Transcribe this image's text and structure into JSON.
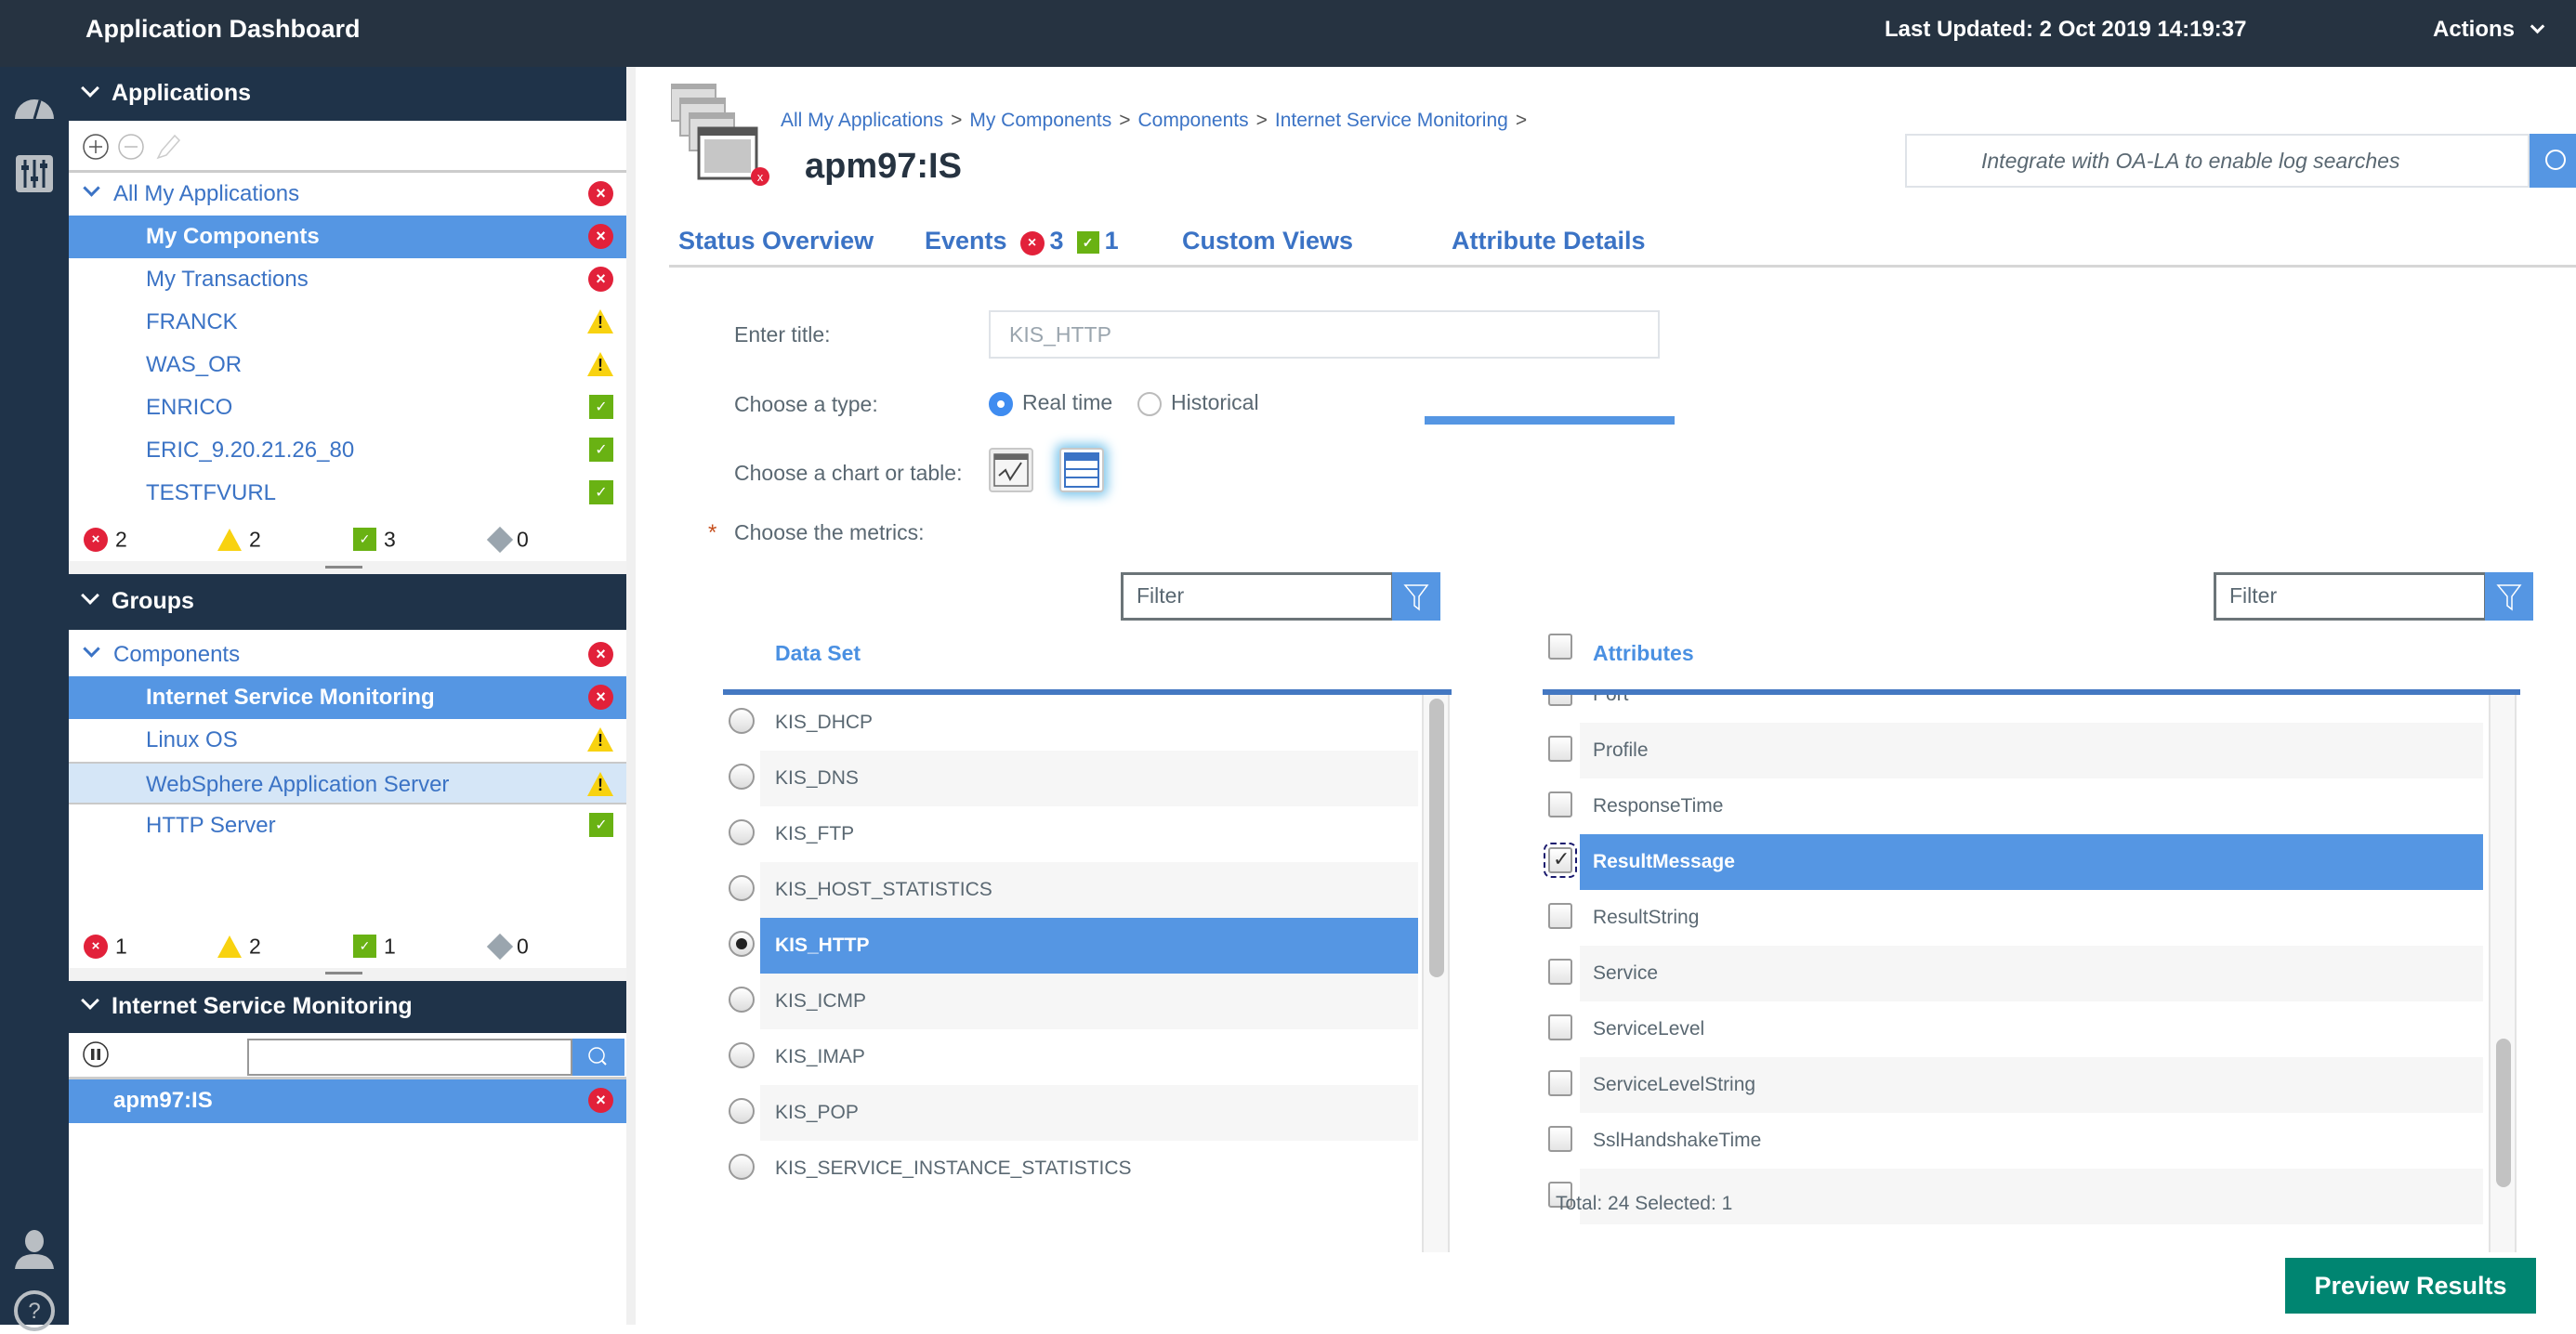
{
  "topbar": {
    "title": "Application Dashboard",
    "last_updated": "Last Updated: 2 Oct 2019 14:19:37",
    "actions_label": "Actions"
  },
  "rail": {
    "icons": [
      "home-icon",
      "dashboard-gauge-icon",
      "settings-sliders-icon",
      "user-icon",
      "help-icon"
    ]
  },
  "sidebar": {
    "applications": {
      "header": "Applications",
      "toolbar": [
        "add-icon",
        "remove-icon",
        "edit-icon"
      ],
      "root": {
        "label": "All My Applications",
        "status": "critical"
      },
      "items": [
        {
          "label": "My Components",
          "status": "critical",
          "selected": true
        },
        {
          "label": "My Transactions",
          "status": "critical"
        },
        {
          "label": "FRANCK",
          "status": "warning"
        },
        {
          "label": "WAS_OR",
          "status": "warning"
        },
        {
          "label": "ENRICO",
          "status": "normal"
        },
        {
          "label": "ERIC_9.20.21.26_80",
          "status": "normal"
        },
        {
          "label": "TESTFVURL",
          "status": "normal"
        }
      ],
      "counts": {
        "critical": "2",
        "warning": "2",
        "normal": "3",
        "unknown": "0"
      }
    },
    "groups": {
      "header": "Groups",
      "root": {
        "label": "Components",
        "status": "critical"
      },
      "items": [
        {
          "label": "Internet Service Monitoring",
          "status": "critical",
          "selected": true
        },
        {
          "label": "Linux OS",
          "status": "warning"
        },
        {
          "label": "WebSphere Application Server",
          "status": "warning",
          "hover": true
        },
        {
          "label": "HTTP Server",
          "status": "normal"
        }
      ],
      "counts": {
        "critical": "1",
        "warning": "2",
        "normal": "1",
        "unknown": "0"
      }
    },
    "instances": {
      "header": "Internet Service Monitoring",
      "search_value": "",
      "items": [
        {
          "label": "apm97:IS",
          "status": "critical",
          "selected": true
        }
      ]
    }
  },
  "main": {
    "breadcrumb": [
      "All My Applications",
      "My Components",
      "Components",
      "Internet Service Monitoring"
    ],
    "breadcrumb_sep": ">",
    "page_title": "apm97:IS",
    "log_search_placeholder": "Integrate with OA-LA to enable log searches",
    "tabs": [
      {
        "label": "Status Overview"
      },
      {
        "label": "Events",
        "critical_count": "3",
        "normal_count": "1"
      },
      {
        "label": "Custom Views"
      },
      {
        "label": "Attribute Details",
        "active": true
      }
    ],
    "form": {
      "title_label": "Enter title:",
      "title_value": "KIS_HTTP",
      "type_label": "Choose a type:",
      "type_options": [
        "Real time",
        "Historical"
      ],
      "type_selected": "Real time",
      "viz_label": "Choose a chart or table:",
      "viz_options": [
        "line-chart-icon",
        "table-icon"
      ],
      "viz_selected": "table-icon",
      "metrics_label": "Choose the metrics:",
      "required_marker": "*"
    },
    "dataset": {
      "filter_placeholder": "Filter",
      "header": "Data Set",
      "items": [
        "KIS_DHCP",
        "KIS_DNS",
        "KIS_FTP",
        "KIS_HOST_STATISTICS",
        "KIS_HTTP",
        "KIS_ICMP",
        "KIS_IMAP",
        "KIS_POP",
        "KIS_SERVICE_INSTANCE_STATISTICS"
      ],
      "selected": "KIS_HTTP"
    },
    "attributes": {
      "filter_placeholder": "Filter",
      "header": "Attributes",
      "items": [
        "Port",
        "Profile",
        "ResponseTime",
        "ResultMessage",
        "ResultString",
        "Service",
        "ServiceLevel",
        "ServiceLevelString",
        "SslHandshakeTime",
        ""
      ],
      "selected": [
        "ResultMessage"
      ],
      "summary": "Total: 24 Selected: 1"
    },
    "preview_button": "Preview Results"
  },
  "colors": {
    "topbar": "#263341",
    "nav": "#1f3349",
    "selection": "#5596e3",
    "link": "#3b73c5",
    "critical": "#e2213a",
    "warning": "#f8d210",
    "normal": "#69b213",
    "primary_button": "#008571"
  }
}
